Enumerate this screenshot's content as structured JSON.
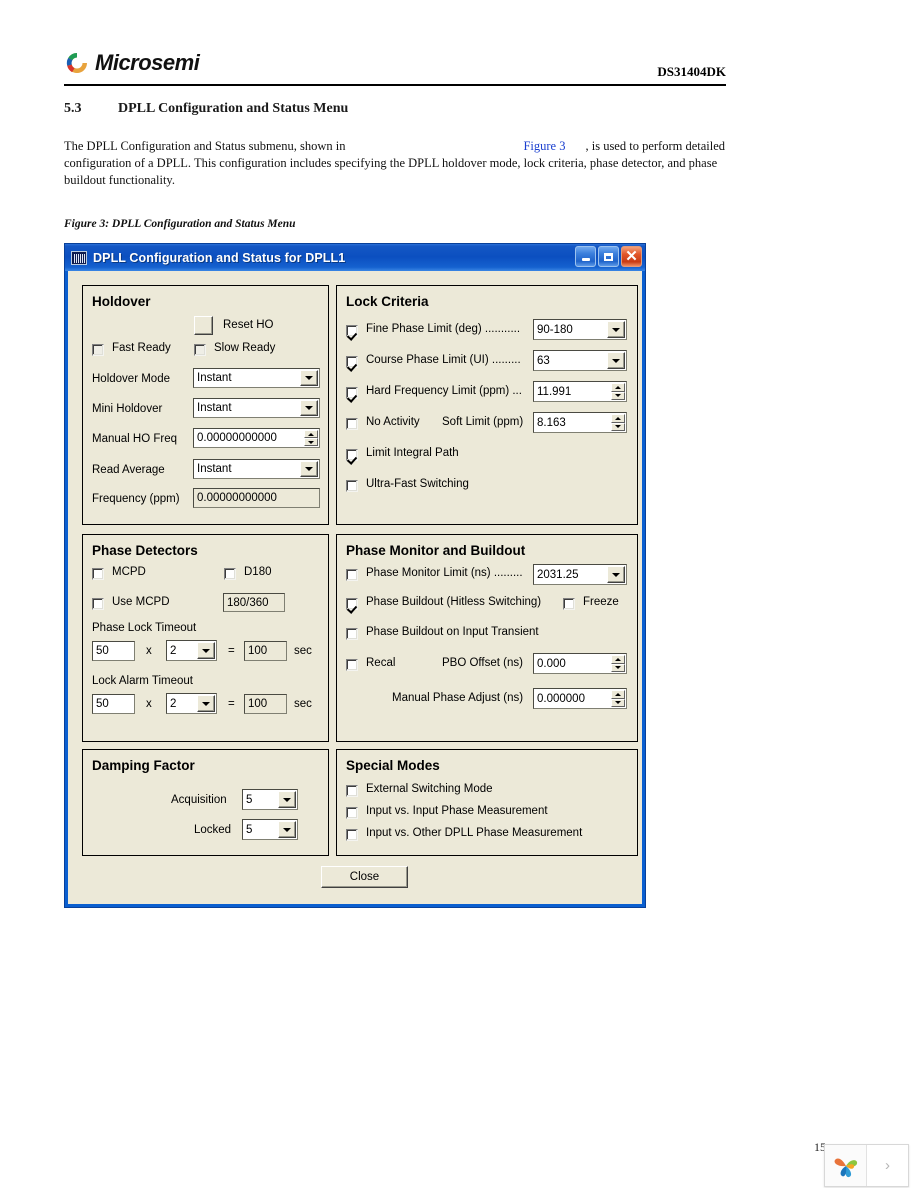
{
  "document": {
    "code": "DS31404DK",
    "brand": "Microsemi",
    "section_number": "5.3",
    "section_title": "DPLL Configuration and Status Menu",
    "paragraph_part1": "The DPLL Configuration and Status submenu, shown in",
    "paragraph_figref": "Figure 3",
    "paragraph_part2": ", is  used to perform detailed configuration of a DPLL. This configuration includes specifying the DPLL holdover mode, lock criteria, phase detector, and phase buildout functionality.",
    "figure_caption": "Figure 3: DPLL Configuration and Status Menu",
    "page_number": "15"
  },
  "dialog": {
    "title": "DPLL Configuration and Status for DPLL1",
    "minimize_label": "Minimize",
    "maximize_label": "Maximize",
    "close_label": "Close",
    "close_button": "Close"
  },
  "holdover": {
    "title": "Holdover",
    "reset_ho_label": "Reset HO",
    "fast_ready_label": "Fast Ready",
    "slow_ready_label": "Slow Ready",
    "holdover_mode_label": "Holdover Mode",
    "holdover_mode_value": "Instant",
    "mini_holdover_label": "Mini Holdover",
    "mini_holdover_value": "Instant",
    "manual_ho_freq_label": "Manual HO Freq",
    "manual_ho_freq_value": "0.00000000000",
    "read_average_label": "Read Average",
    "read_average_value": "Instant",
    "frequency_label": "Frequency (ppm)",
    "frequency_value": "0.00000000000"
  },
  "lock_criteria": {
    "title": "Lock Criteria",
    "fine_phase_label": "Fine Phase Limit (deg) ...........",
    "fine_phase_value": "90-180",
    "course_phase_label": "Course Phase Limit (UI) .........",
    "course_phase_value": "63",
    "hard_freq_label": "Hard Frequency Limit (ppm) ...",
    "hard_freq_value": "11.991",
    "no_activity_label": "No Activity",
    "soft_limit_label": "Soft Limit (ppm)",
    "soft_limit_value": "8.163",
    "limit_integral_label": "Limit Integral Path",
    "ultra_fast_label": "Ultra-Fast Switching"
  },
  "phase_detectors": {
    "title": "Phase Detectors",
    "mcpd_label": "MCPD",
    "d180_label": "D180",
    "use_mcpd_label": "Use MCPD",
    "mcpd_ratio_value": "180/360",
    "phase_lock_timeout_label": "Phase Lock Timeout",
    "phase_lock_base": "50",
    "phase_lock_mult_symbol": "x",
    "phase_lock_mult": "2",
    "phase_lock_eq_symbol": "=",
    "phase_lock_result": "100",
    "phase_lock_unit": "sec",
    "lock_alarm_timeout_label": "Lock Alarm Timeout",
    "lock_alarm_base": "50",
    "lock_alarm_mult_symbol": "x",
    "lock_alarm_mult": "2",
    "lock_alarm_eq_symbol": "=",
    "lock_alarm_result": "100",
    "lock_alarm_unit": "sec"
  },
  "phase_monitor": {
    "title": "Phase Monitor and Buildout",
    "monitor_limit_label": "Phase Monitor Limit (ns) .........",
    "monitor_limit_value": "2031.25",
    "buildout_label": "Phase Buildout (Hitless Switching)",
    "freeze_label": "Freeze",
    "buildout_transient_label": "Phase Buildout on Input Transient",
    "recal_label": "Recal",
    "pbo_offset_label": "PBO Offset (ns)",
    "pbo_offset_value": "0.000",
    "manual_phase_label": "Manual Phase Adjust (ns)",
    "manual_phase_value": "0.000000"
  },
  "damping_factor": {
    "title": "Damping Factor",
    "acquisition_label": "Acquisition",
    "acquisition_value": "5",
    "locked_label": "Locked",
    "locked_value": "5"
  },
  "special_modes": {
    "title": "Special Modes",
    "external_switching_label": "External Switching Mode",
    "input_vs_input_label": "Input vs. Input Phase Measurement",
    "input_vs_other_label": "Input vs. Other DPLL Phase Measurement"
  },
  "colors": {
    "titlebar_blue": "#0b4fc0",
    "dialog_face": "#ece9d8",
    "link_blue": "#1a3fcf",
    "close_red": "#c83b14"
  }
}
